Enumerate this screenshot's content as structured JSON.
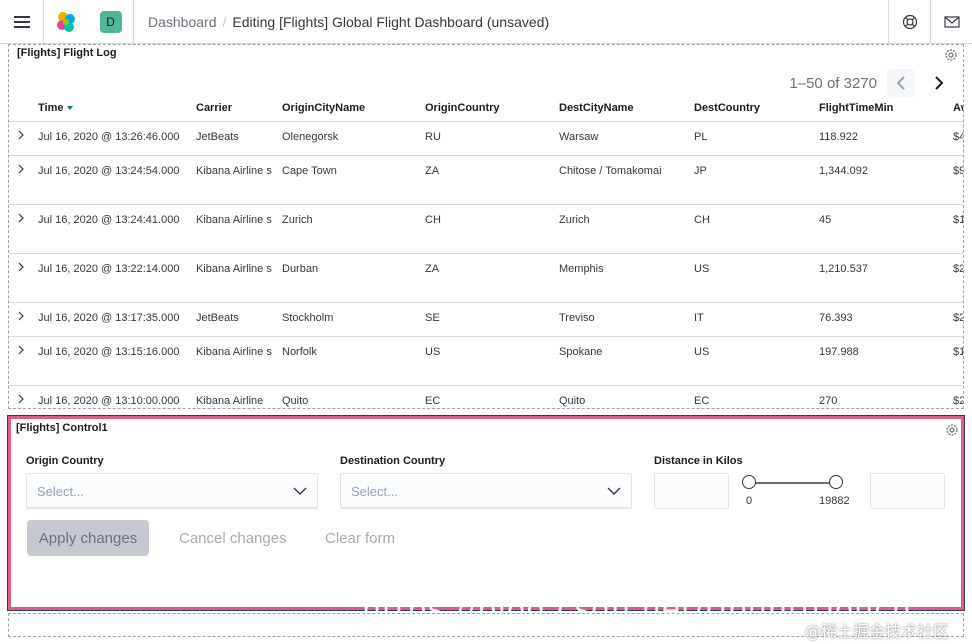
{
  "header": {
    "space_initial": "D",
    "breadcrumb_parent": "Dashboard",
    "breadcrumb_separator": "/",
    "breadcrumb_current": "Editing [Flights] Global Flight Dashboard (unsaved)"
  },
  "flight_log": {
    "title": "[Flights] Flight Log",
    "pagination_label": "1–50 of 3270",
    "columns": [
      "Time",
      "Carrier",
      "OriginCityName",
      "OriginCountry",
      "DestCityName",
      "DestCountry",
      "FlightTimeMin",
      "Av"
    ],
    "rows": [
      {
        "time": "Jul 16, 2020 @ 13:26:46.000",
        "carrier": "JetBeats",
        "origin_city": "Olenegorsk",
        "origin_country": "RU",
        "dest_city": "Warsaw",
        "dest_country": "PL",
        "flight_time": "118.922",
        "avg": "$4"
      },
      {
        "time": "Jul 16, 2020 @ 13:24:54.000",
        "carrier": "Kibana Airline s",
        "origin_city": "Cape Town",
        "origin_country": "ZA",
        "dest_city": "Chitose / Tomakomai",
        "dest_country": "JP",
        "flight_time": "1,344.092",
        "avg": "$9"
      },
      {
        "time": "Jul 16, 2020 @ 13:24:41.000",
        "carrier": "Kibana Airline s",
        "origin_city": "Zurich",
        "origin_country": "CH",
        "dest_city": "Zurich",
        "dest_country": "CH",
        "flight_time": "45",
        "avg": "$1"
      },
      {
        "time": "Jul 16, 2020 @ 13:22:14.000",
        "carrier": "Kibana Airline s",
        "origin_city": "Durban",
        "origin_country": "ZA",
        "dest_city": "Memphis",
        "dest_country": "US",
        "flight_time": "1,210.537",
        "avg": "$2"
      },
      {
        "time": "Jul 16, 2020 @ 13:17:35.000",
        "carrier": "JetBeats",
        "origin_city": "Stockholm",
        "origin_country": "SE",
        "dest_city": "Treviso",
        "dest_country": "IT",
        "flight_time": "76.393",
        "avg": "$2"
      },
      {
        "time": "Jul 16, 2020 @ 13:15:16.000",
        "carrier": "Kibana Airline s",
        "origin_city": "Norfolk",
        "origin_country": "US",
        "dest_city": "Spokane",
        "dest_country": "US",
        "flight_time": "197.988",
        "avg": "$1"
      },
      {
        "time": "Jul 16, 2020 @ 13:10:00.000",
        "carrier": "Kibana Airline",
        "origin_city": "Quito",
        "origin_country": "EC",
        "dest_city": "Quito",
        "dest_country": "EC",
        "flight_time": "270",
        "avg": "$2"
      }
    ]
  },
  "control_panel": {
    "title": "[Flights] Control1",
    "origin_label": "Origin Country",
    "origin_placeholder": "Select...",
    "dest_label": "Destination Country",
    "dest_placeholder": "Select...",
    "distance_label": "Distance in Kilos",
    "range_min": "0",
    "range_max": "19882",
    "apply_label": "Apply changes",
    "cancel_label": "Cancel changes",
    "clear_label": "Clear form"
  },
  "overlay": {
    "url_text": "https://blog.csdn.net/UbuntuTouch",
    "watermark": "@稀土掘金技术社区"
  },
  "colors": {
    "highlight_border": "#e05b8c",
    "accent": "#006bb4",
    "space_avatar": "#54b399"
  }
}
